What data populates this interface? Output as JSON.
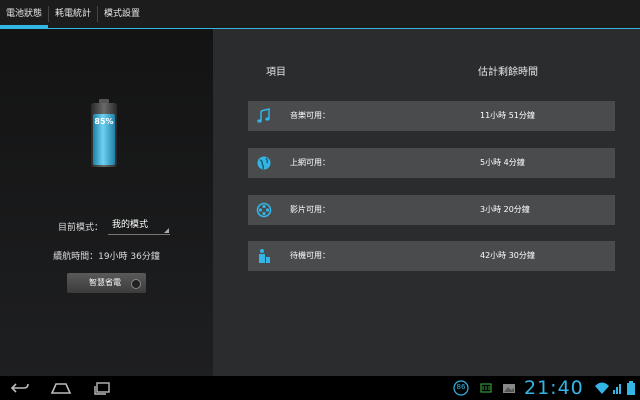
{
  "tabs": [
    {
      "label": "電池狀態",
      "selected": true
    },
    {
      "label": "耗電統計",
      "selected": false
    },
    {
      "label": "模式設置",
      "selected": false
    }
  ],
  "battery": {
    "percent_text": "85%",
    "level": 0.85,
    "color": "#33b5e5"
  },
  "mode": {
    "label": "目前模式：",
    "value": "我的模式"
  },
  "runtime_text": "續航時間：19小時 36分鐘",
  "smart_button_label": "智慧省電",
  "table": {
    "header_item": "項目",
    "header_time": "估計剩餘時間",
    "rows": [
      {
        "icon": "music-note-icon",
        "label": "音樂可用：",
        "value": "11小時 51分鐘"
      },
      {
        "icon": "globe-icon",
        "label": "上網可用：",
        "value": "5小時 4分鐘"
      },
      {
        "icon": "film-reel-icon",
        "label": "影片可用：",
        "value": "3小時 20分鐘"
      },
      {
        "icon": "standby-icon",
        "label": "待機可用：",
        "value": "42小時 30分鐘"
      }
    ]
  },
  "statusbar": {
    "time": "21:40",
    "badge": "86",
    "accent": "#33b5e5"
  }
}
